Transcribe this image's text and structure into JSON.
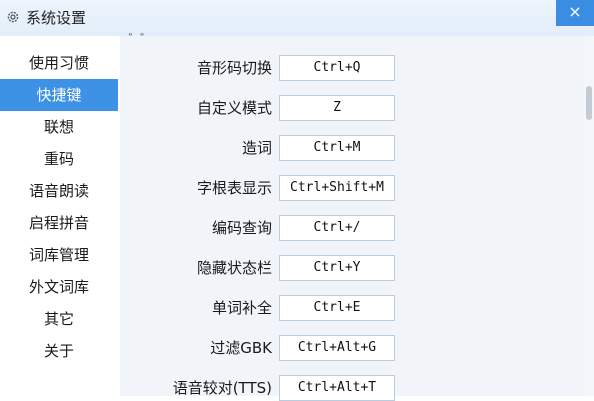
{
  "window": {
    "title": "系统设置",
    "close_glyph": "×",
    "icon": "gear-icon"
  },
  "sidebar": {
    "items": [
      {
        "label": "使用习惯",
        "active": false
      },
      {
        "label": "快捷键",
        "active": true
      },
      {
        "label": "联想",
        "active": false
      },
      {
        "label": "重码",
        "active": false
      },
      {
        "label": "语音朗读",
        "active": false
      },
      {
        "label": "启程拼音",
        "active": false
      },
      {
        "label": "词库管理",
        "active": false
      },
      {
        "label": "外文词库",
        "active": false
      },
      {
        "label": "其它",
        "active": false
      },
      {
        "label": "关于",
        "active": false
      }
    ]
  },
  "main": {
    "section_marker": "\" \"",
    "hotkeys": [
      {
        "label": "音形码切换",
        "value": "Ctrl+Q"
      },
      {
        "label": "自定义模式",
        "value": "Z"
      },
      {
        "label": "造词",
        "value": "Ctrl+M"
      },
      {
        "label": "字根表显示",
        "value": "Ctrl+Shift+M"
      },
      {
        "label": "编码查询",
        "value": "Ctrl+/"
      },
      {
        "label": "隐藏状态栏",
        "value": "Ctrl+Y"
      },
      {
        "label": "单词补全",
        "value": "Ctrl+E"
      },
      {
        "label": "过滤GBK",
        "value": "Ctrl+Alt+G"
      },
      {
        "label": "语音较对(TTS)",
        "value": "Ctrl+Alt+T"
      }
    ]
  },
  "colors": {
    "accent": "#3d92e6",
    "close_button": "#3b8de4",
    "content_background": "#f1f4f8"
  }
}
